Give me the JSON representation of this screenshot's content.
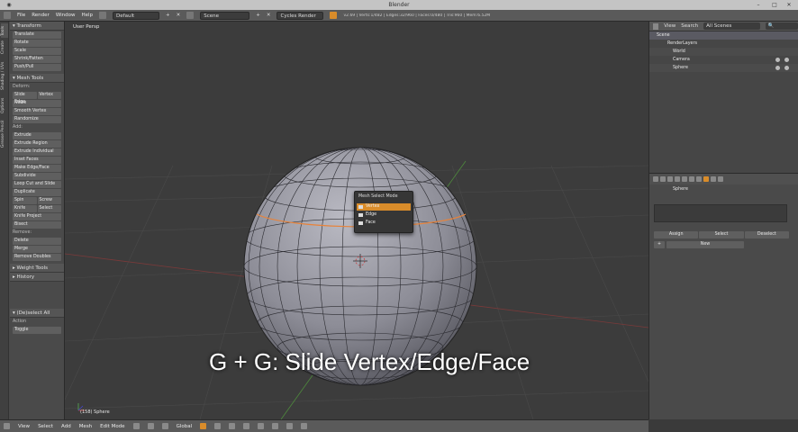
{
  "window": {
    "title": "Blender"
  },
  "topbar": {
    "menus": [
      "File",
      "Render",
      "Window",
      "Help"
    ],
    "layout": "Default",
    "scene": "Scene",
    "engine": "Cycles Render",
    "stats": "v2.69 | Verts:1/482 | Edges:32/960 | Faces:0/480 | Tris:960 | Mem:6.52M"
  },
  "toolshelf": {
    "tabs": [
      "Tools",
      "Create",
      "Shading / UVs",
      "Options",
      "Grease Pencil"
    ],
    "transform_header": "Transform",
    "transform": [
      "Translate",
      "Rotate",
      "Scale",
      "Shrink/Fatten",
      "Push/Pull"
    ],
    "mesh_tools_header": "Mesh Tools",
    "deform_label": "Deform:",
    "slide_edge": "Slide Edge",
    "vertex": "Vertex",
    "deform_items": [
      "Noise",
      "Smooth Vertex",
      "Randomize"
    ],
    "add_label": "Add:",
    "add_items": [
      "Extrude",
      "Extrude Region",
      "Extrude Individual",
      "Inset Faces",
      "Make Edge/Face",
      "Subdivide",
      "Loop Cut and Slide",
      "Duplicate"
    ],
    "spin": "Spin",
    "screw": "Screw",
    "knife": "Knife",
    "select": "Select",
    "knife_project": "Knife Project",
    "bisect": "Bisect",
    "remove_label": "Remove:",
    "delete": "Delete",
    "merge": "Merge",
    "remove_doubles": "Remove Doubles",
    "weight_tools": "Weight Tools",
    "history": "History",
    "deselect_all": "(De)select All",
    "action_label": "Action",
    "action_value": "Toggle"
  },
  "viewport": {
    "label": "User Persp",
    "object": "(158) Sphere",
    "caption": "G + G: Slide Vertex/Edge/Face"
  },
  "popup": {
    "title": "Mesh Select Mode",
    "items": [
      "Vertex",
      "Edge",
      "Face"
    ]
  },
  "outliner": {
    "view": "View",
    "search": "Search",
    "scenes": "All Scenes",
    "rows": [
      "Scene",
      "RenderLayers",
      "World",
      "Camera",
      "Sphere"
    ]
  },
  "properties": {
    "object": "Sphere",
    "assign": "Assign",
    "select": "Select",
    "deselect": "Deselect",
    "new": "New"
  },
  "bottombar": {
    "menus": [
      "View",
      "Select",
      "Add",
      "Mesh"
    ],
    "mode": "Edit Mode",
    "orientation": "Global"
  },
  "colors": {
    "accent": "#d98c2a",
    "viewport_bg": "#3c3c3c",
    "selected_edge": "#e8833a"
  }
}
